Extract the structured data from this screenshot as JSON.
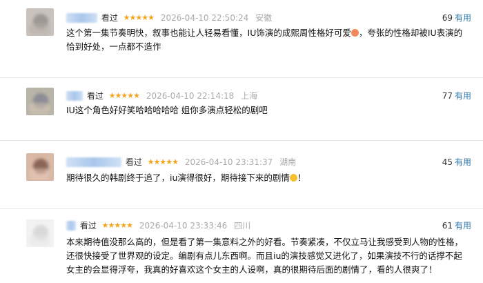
{
  "reviews": [
    {
      "status": "看过",
      "stars": "★★★★★",
      "time": "2026-04-10 22:50:24",
      "location": "安徽",
      "votes": "69",
      "useful_label": "有用",
      "content": "这个第一集节奏明快，叙事也能让人轻易看懂，IU饰演的成熙周性格好可爱",
      "content_tail": "，夸张的性格却被IU表演的恰到好处，一点都不造作",
      "emoji": "smiling-face-with-hearts",
      "avatar_colors": [
        "#c9c2bd",
        "#8f8a86",
        "#b8b0a9"
      ]
    },
    {
      "status": "看过",
      "stars": "★★★★★",
      "time": "2026-04-10 22:14:18",
      "location": "上海",
      "votes": "77",
      "useful_label": "有用",
      "content": "IU这个角色好好笑哈哈哈哈哈 姐你多演点轻松的剧吧",
      "avatar_colors": [
        "#b9b4a8",
        "#7c7f8f",
        "#d6c7b5"
      ]
    },
    {
      "status": "看过",
      "stars": "★★★★★",
      "time": "2026-04-10 23:31:37",
      "location": "湖南",
      "votes": "45",
      "useful_label": "有用",
      "content": "期待很久的韩剧终于追了，iu演得很好，期待接下来的剧情",
      "content_tail": "！",
      "emoji": "smiling-face",
      "avatar_colors": [
        "#d9b8a6",
        "#6f4b3d",
        "#e7c9b8"
      ]
    },
    {
      "status": "看过",
      "stars": "★★★★★",
      "time": "2026-04-10 23:33:46",
      "location": "四川",
      "votes": "61",
      "useful_label": "有用",
      "content": "本来期待值没那么高的，但是看了第一集意料之外的好看。节奏紧凑，不仅立马让我感受到人物的性格，还很快接受了世界观的设定。编剧有点儿东西啊。而且iu的演技感觉又进化了，如果演技不行的话撑不起女主的会显得浮夸，我真的好喜欢这个女主的人设啊，真的很期待后面的剧情了，看的人很爽了！",
      "avatar_colors": [
        "#f2f2f2",
        "#d0d0d0",
        "#e6e6e6"
      ]
    }
  ]
}
